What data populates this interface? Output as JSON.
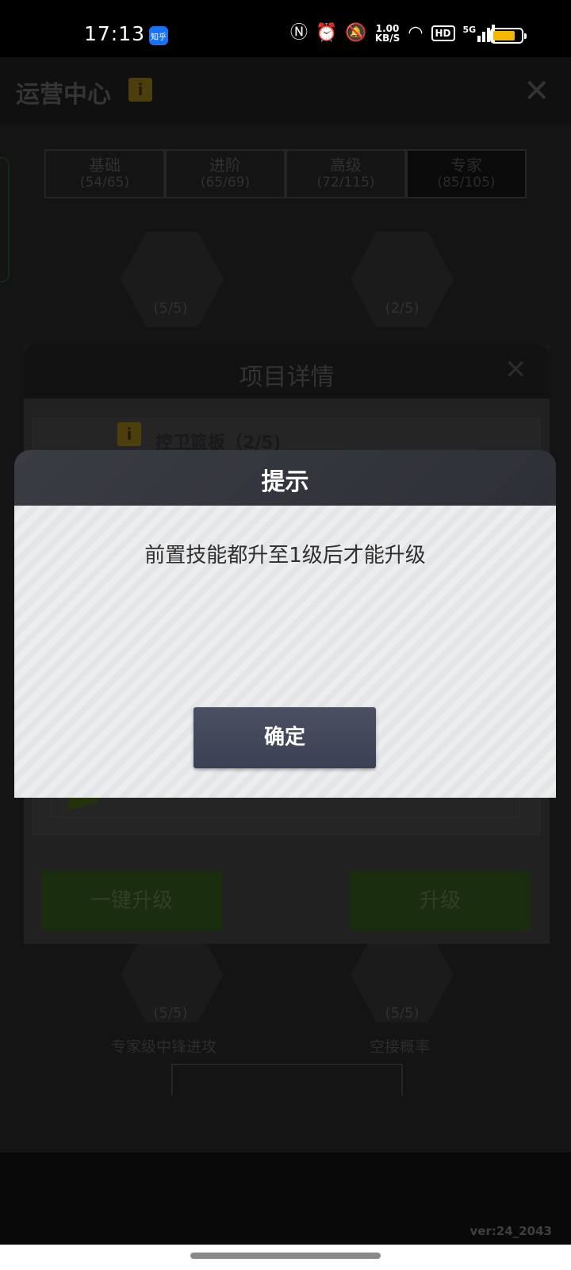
{
  "status_bar": {
    "time": "17:13",
    "app_badge": "知乎",
    "net_speed_value": "1.00",
    "net_speed_unit": "KB/S",
    "hd_label": "HD",
    "network_label": "5G",
    "battery_level": 0.8
  },
  "header": {
    "title": "运营中心"
  },
  "tabs": [
    {
      "label": "基础",
      "count": "(54/65)"
    },
    {
      "label": "进阶",
      "count": "(65/69)"
    },
    {
      "label": "高级",
      "count": "(72/115)"
    },
    {
      "label": "专家",
      "count": "(85/105)"
    }
  ],
  "background_skills": {
    "top_left_level": "(5/5)",
    "top_right_level": "(2/5)",
    "bottom_left_level": "(5/5)",
    "bottom_left_name": "专家级中锋进攻",
    "bottom_right_level": "(5/5)",
    "bottom_right_name": "空接概率"
  },
  "detail_panel": {
    "title": "项目详情",
    "item_name": "控卫篮板（2/5)",
    "one_click_upgrade": "一键升级",
    "upgrade": "升级"
  },
  "dialog": {
    "title": "提示",
    "message": "前置技能都升至1级后才能升级",
    "confirm": "确定"
  },
  "footer": {
    "version": "ver:24_2043"
  }
}
